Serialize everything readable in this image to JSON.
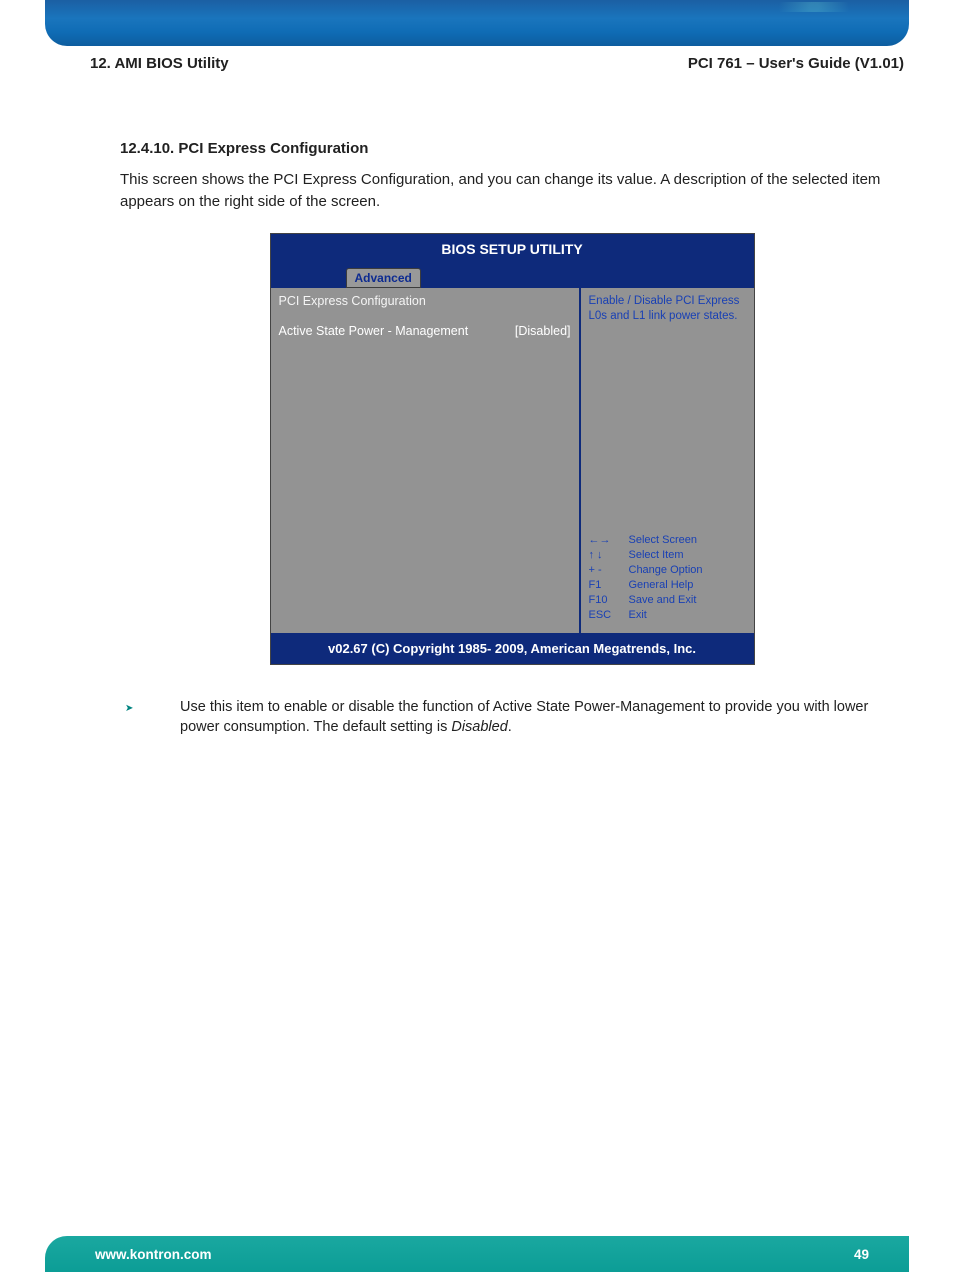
{
  "header": {
    "left": "12. AMI BIOS Utility",
    "right": "PCI 761 – User's Guide (V1.01)"
  },
  "section": {
    "number": "12.4.10.",
    "title": "PCI Express Configuration",
    "intro": "This screen shows the PCI Express Configuration, and you can change its value. A description of the selected item appears on the right side of the screen."
  },
  "bios": {
    "window_title": "BIOS SETUP UTILITY",
    "tab": "Advanced",
    "left_title": "PCI  Express Configuration",
    "option_label": "Active State Power - Management",
    "option_value": "[Disabled]",
    "help_text": "Enable / Disable PCI Express L0s and L1 link power states.",
    "keys": [
      {
        "key": "←→",
        "desc": "Select Screen"
      },
      {
        "key": "↑ ↓",
        "desc": "Select Item"
      },
      {
        "key": "+  -",
        "desc": "Change Option"
      },
      {
        "key": "F1",
        "desc": "General Help"
      },
      {
        "key": "F10",
        "desc": "Save and Exit"
      },
      {
        "key": "ESC",
        "desc": "Exit"
      }
    ],
    "footer": "v02.67 (C) Copyright 1985- 2009, American Megatrends, Inc."
  },
  "note": {
    "bullet": "➤",
    "text_before": "Use this item to enable or disable the function of Active State Power-Management to provide you with lower power consumption. The default setting is ",
    "italic": "Disabled",
    "text_after": "."
  },
  "footer": {
    "url": "www.kontron.com",
    "page": "49"
  }
}
